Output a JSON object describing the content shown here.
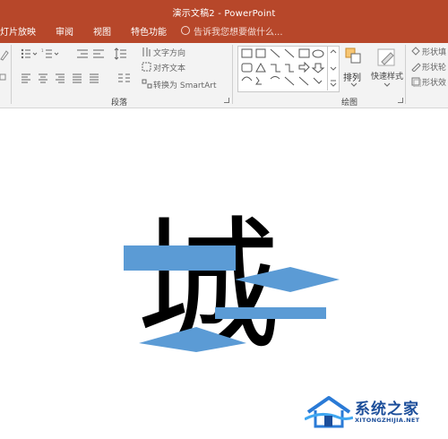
{
  "window": {
    "title": "演示文稿2 - PowerPoint"
  },
  "menu": {
    "tabs": [
      "灯片放映",
      "审阅",
      "视图",
      "特色功能"
    ],
    "tell_me": "告诉我您想要做什么..."
  },
  "ribbon": {
    "paragraph": {
      "label": "段落",
      "text_direction": "文字方向",
      "align_text": "对齐文本",
      "convert_smartart": "转换为 SmartArt"
    },
    "drawing": {
      "label": "绘图",
      "arrange": "排列",
      "quick_styles": "快速样式",
      "shape_fill": "形状填",
      "shape_outline": "形状轮",
      "shape_effects": "形状效"
    }
  },
  "slide": {
    "character": "城",
    "shape_color": "#5b9bd5"
  },
  "watermark": {
    "text": "系统之家",
    "url": "XITONGZHIJIA.NET"
  },
  "colors": {
    "accent": "#b7472a",
    "ribbon_bg": "#f3f3f3",
    "watermark_blue": "#1c4e9a"
  }
}
